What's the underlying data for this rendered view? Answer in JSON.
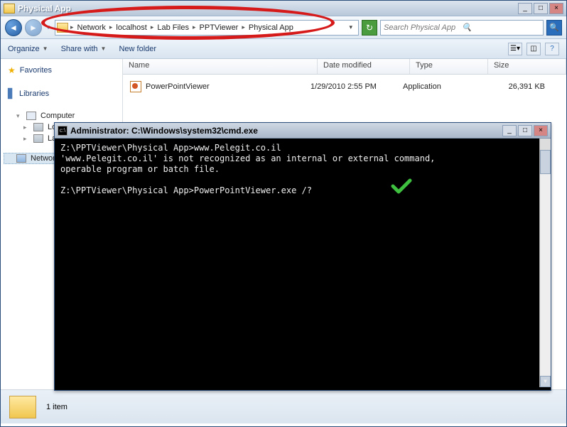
{
  "window": {
    "title": "Physical App"
  },
  "nav": {
    "breadcrumb": [
      "Network",
      "localhost",
      "Lab Files",
      "PPTViewer",
      "Physical App"
    ],
    "search_placeholder": "Search Physical App"
  },
  "toolbar": {
    "organize": "Organize",
    "share": "Share with",
    "newfolder": "New folder"
  },
  "sidebar": {
    "favorites": "Favorites",
    "libraries": "Libraries",
    "computer": "Computer",
    "local": "Local Disk (C:)",
    "labfiles": "Lab Files (Z:)",
    "network": "Network"
  },
  "cols": {
    "name": "Name",
    "date": "Date modified",
    "type": "Type",
    "size": "Size"
  },
  "files": [
    {
      "name": "PowerPointViewer",
      "date": "1/29/2010 2:55 PM",
      "type": "Application",
      "size": "26,391 KB"
    }
  ],
  "details": {
    "count": "1 item"
  },
  "cmd": {
    "title": "Administrator: C:\\Windows\\system32\\cmd.exe",
    "line1_prompt": "Z:\\PPTViewer\\Physical App>",
    "line1_cmd": "www.Pelegit.co.il",
    "line2": "'www.Pelegit.co.il' is not recognized as an internal or external command,",
    "line3": "operable program or batch file.",
    "line4_prompt": "Z:\\PPTViewer\\Physical App>",
    "line4_cmd": "PowerPointViewer.exe /?"
  }
}
